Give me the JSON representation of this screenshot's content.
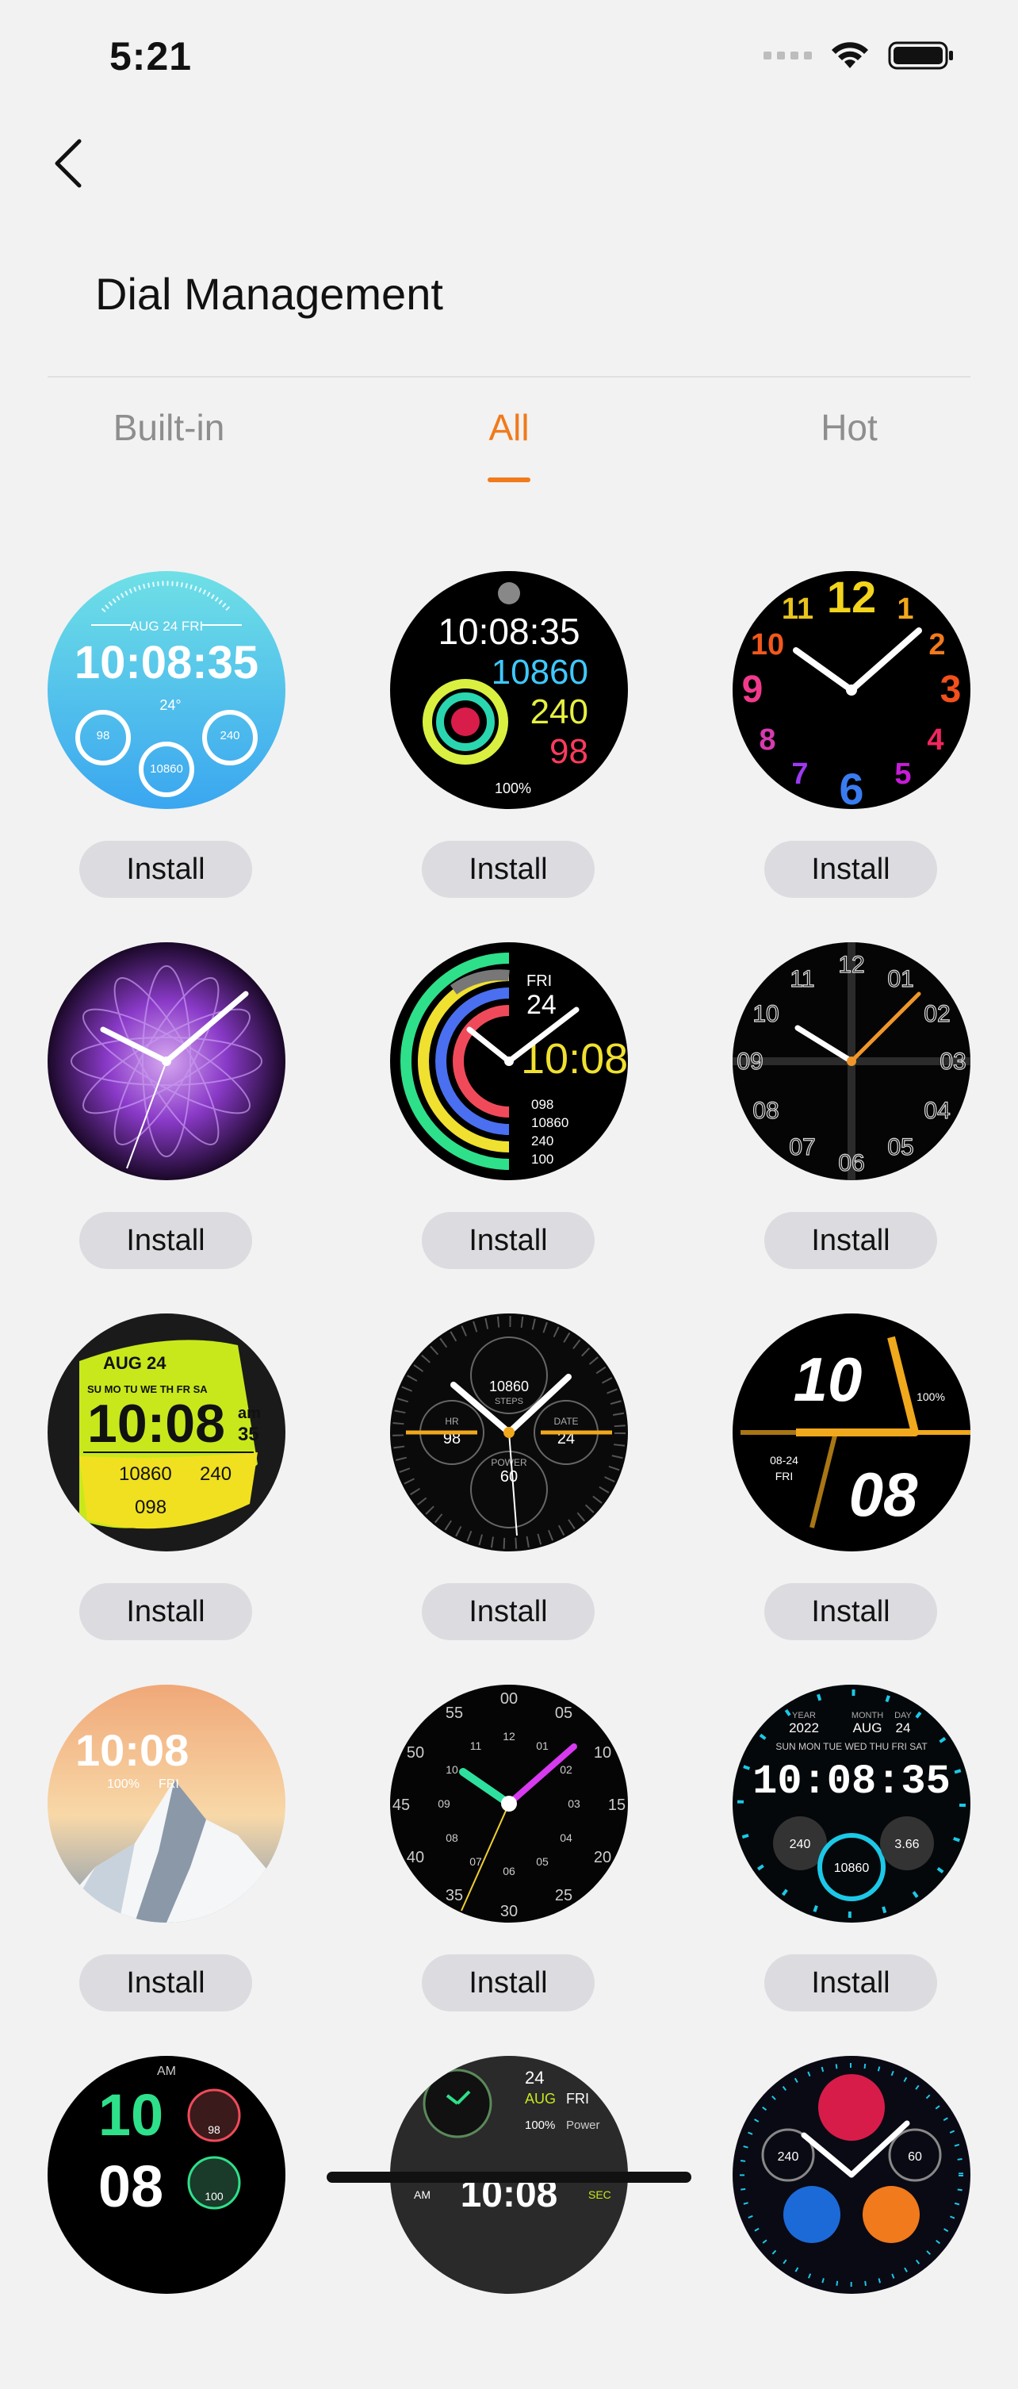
{
  "status": {
    "time": "5:21"
  },
  "header": {
    "title": "Dial Management"
  },
  "tabs": [
    {
      "label": "Built-in",
      "active": false
    },
    {
      "label": "All",
      "active": true
    },
    {
      "label": "Hot",
      "active": false
    }
  ],
  "install_label": "Install",
  "dials": [
    {
      "id": "dial-1",
      "text": [
        "AUG 24 FRI",
        "10:08:35",
        "24°",
        "98",
        "10860",
        "240"
      ]
    },
    {
      "id": "dial-2",
      "text": [
        "10:08:35",
        "10860",
        "240",
        "98",
        "100%"
      ]
    },
    {
      "id": "dial-3",
      "text": [
        "12",
        "1",
        "2",
        "3",
        "4",
        "5",
        "6",
        "7",
        "8",
        "9",
        "10",
        "11"
      ]
    },
    {
      "id": "dial-4",
      "text": []
    },
    {
      "id": "dial-5",
      "text": [
        "FRI",
        "24",
        "10:08",
        "098",
        "10860",
        "240",
        "100"
      ]
    },
    {
      "id": "dial-6",
      "text": [
        "12",
        "01",
        "02",
        "03",
        "04",
        "05",
        "06",
        "07",
        "08",
        "09",
        "10",
        "11"
      ]
    },
    {
      "id": "dial-7",
      "text": [
        "AUG 24",
        "SU MO TU WE TH FR SA",
        "10:08",
        "am",
        "35",
        "10860",
        "240",
        "098"
      ]
    },
    {
      "id": "dial-8",
      "text": [
        "10860",
        "STEPS",
        "HR",
        "98",
        "DATE",
        "24",
        "POWER",
        "60"
      ]
    },
    {
      "id": "dial-9",
      "text": [
        "10",
        "08",
        "100%",
        "08-24",
        "FRI"
      ]
    },
    {
      "id": "dial-10",
      "text": [
        "10:08",
        "100%",
        "FRI"
      ]
    },
    {
      "id": "dial-11",
      "text": [
        "00",
        "05",
        "10",
        "15",
        "20",
        "25",
        "30",
        "35",
        "40",
        "45",
        "50",
        "55",
        "12",
        "01",
        "02",
        "03",
        "04",
        "05",
        "06",
        "07",
        "08",
        "09",
        "10",
        "11"
      ]
    },
    {
      "id": "dial-12",
      "text": [
        "YEAR",
        "2022",
        "MONTH",
        "AUG",
        "DAY",
        "24",
        "SUN MON TUE WED THU FRI SAT",
        "10:08:35",
        "240",
        "10860",
        "3.66"
      ]
    },
    {
      "id": "dial-13",
      "text": [
        "AM",
        "10",
        "08",
        "98",
        "100"
      ]
    },
    {
      "id": "dial-14",
      "text": [
        "24",
        "AUG",
        "FRI",
        "100%",
        "Power",
        "AM",
        "10:08",
        "SEC"
      ]
    },
    {
      "id": "dial-15",
      "text": [
        "240",
        "60"
      ]
    }
  ]
}
